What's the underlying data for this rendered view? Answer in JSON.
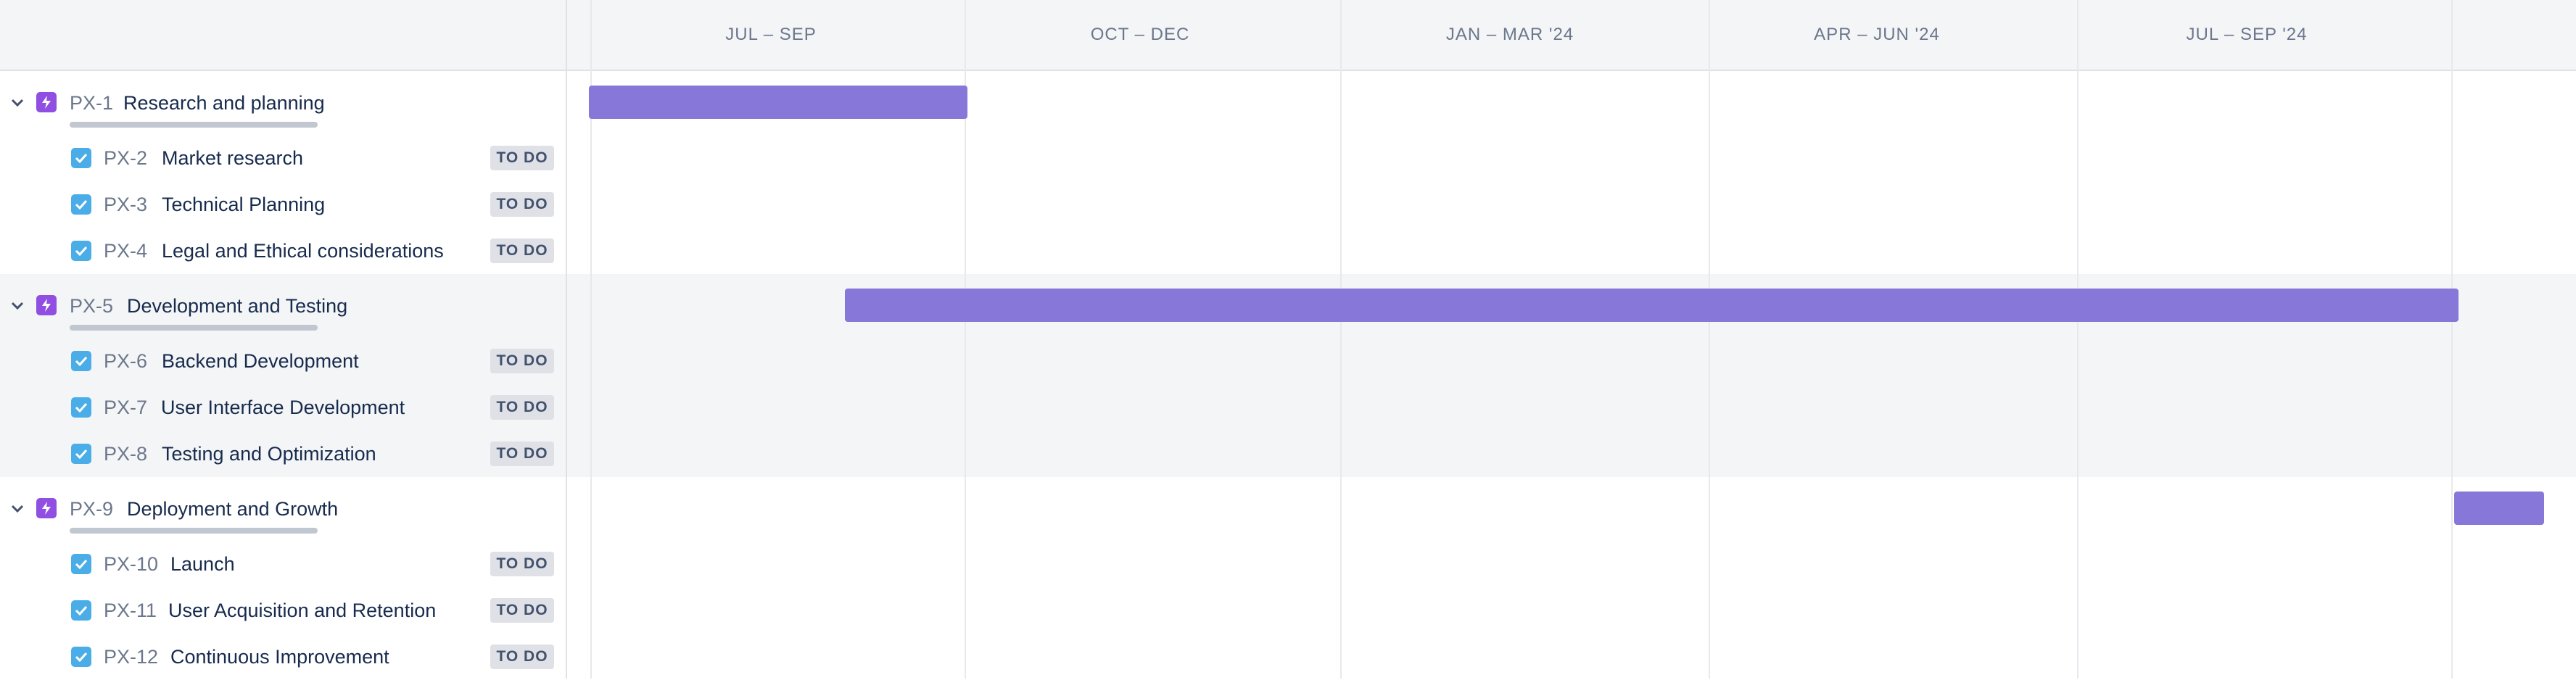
{
  "timeline": {
    "quarters": [
      "JUL – SEP",
      "OCT – DEC",
      "JAN – MAR '24",
      "APR – JUN '24",
      "JUL – SEP '24",
      ""
    ]
  },
  "issues": {
    "epics": [
      {
        "key": "PX-1",
        "summary": "Research and planning",
        "tasks": [
          {
            "key": "PX-2",
            "summary": "Market research",
            "status": "TO DO"
          },
          {
            "key": "PX-3",
            "summary": "Technical Planning",
            "status": "TO DO"
          },
          {
            "key": "PX-4",
            "summary": "Legal and Ethical considerations",
            "status": "TO DO"
          }
        ]
      },
      {
        "key": "PX-5",
        "summary": "Development and Testing",
        "tasks": [
          {
            "key": "PX-6",
            "summary": "Backend Development",
            "status": "TO DO"
          },
          {
            "key": "PX-7",
            "summary": "User Interface Development",
            "status": "TO DO"
          },
          {
            "key": "PX-8",
            "summary": "Testing and Optimization",
            "status": "TO DO"
          }
        ]
      },
      {
        "key": "PX-9",
        "summary": "Deployment and Growth",
        "tasks": [
          {
            "key": "PX-10",
            "summary": "Launch",
            "status": "TO DO"
          },
          {
            "key": "PX-11",
            "summary": "User Acquisition and Retention",
            "status": "TO DO"
          },
          {
            "key": "PX-12",
            "summary": "Continuous Improvement",
            "status": "TO DO"
          }
        ]
      }
    ]
  },
  "colors": {
    "epic_bar": "#8777d9",
    "epic_icon": "#904ee2",
    "task_icon": "#4bade8",
    "band": "#f4f5f7"
  },
  "icons": {
    "epic": "lightning-bolt-icon",
    "task": "checkbox-icon",
    "expand": "chevron-down-icon"
  }
}
